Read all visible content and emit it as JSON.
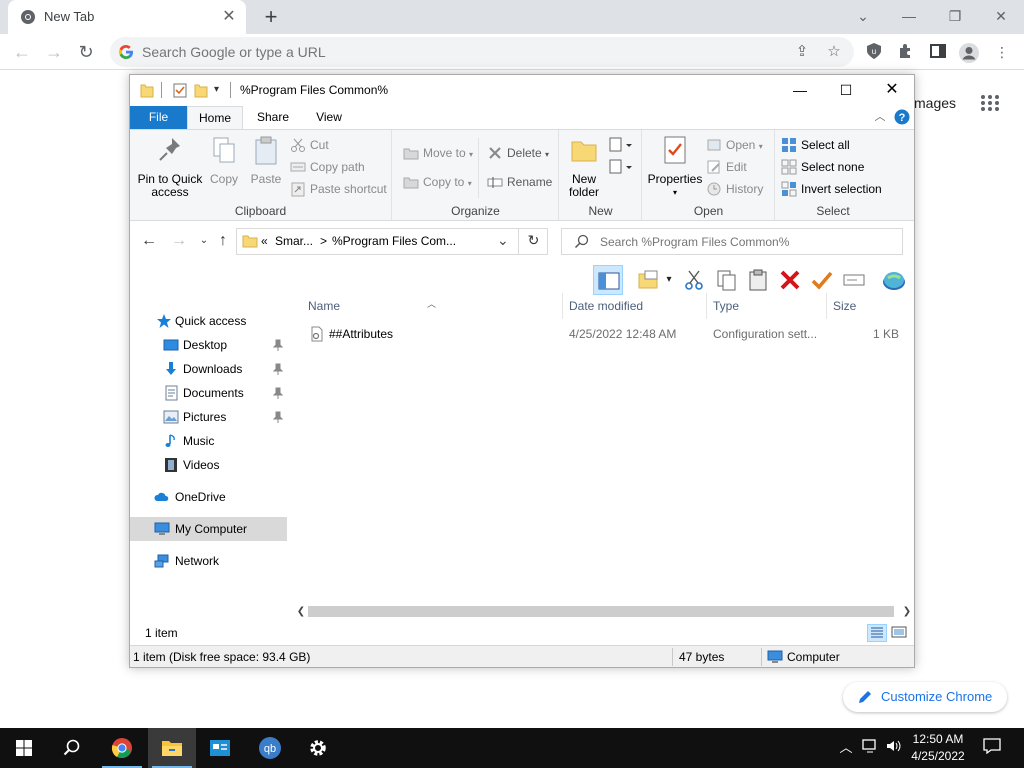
{
  "chrome": {
    "tab_title": "New Tab",
    "tab_close_icon": "close-icon",
    "new_tab_icon": "plus-icon",
    "omnibox_placeholder": "Search Google or type a URL",
    "ntp_apps_text": "mages",
    "customize_label": "Customize Chrome"
  },
  "explorer": {
    "title": "%Program Files Common%",
    "ribbon_tabs": [
      "File",
      "Home",
      "Share",
      "View"
    ],
    "clipboard": {
      "pin_label_1": "Pin to Quick",
      "pin_label_2": "access",
      "copy": "Copy",
      "paste": "Paste",
      "cut": "Cut",
      "copy_path": "Copy path",
      "paste_shortcut": "Paste shortcut",
      "group": "Clipboard"
    },
    "organize": {
      "move_to": "Move to",
      "copy_to": "Copy to",
      "delete": "Delete",
      "rename": "Rename",
      "group": "Organize"
    },
    "new": {
      "new_folder_1": "New",
      "new_folder_2": "folder",
      "group": "New"
    },
    "open": {
      "properties": "Properties",
      "open": "Open",
      "edit": "Edit",
      "history": "History",
      "group": "Open"
    },
    "select": {
      "select_all": "Select all",
      "select_none": "Select none",
      "invert": "Invert selection",
      "group": "Select"
    },
    "address": {
      "chevrons": "«",
      "crumb1": "Smar...",
      "sep": ">",
      "crumb2": "%Program Files Com..."
    },
    "search_placeholder": "Search %Program Files Common%",
    "nav": {
      "quick_access": "Quick access",
      "desktop": "Desktop",
      "downloads": "Downloads",
      "documents": "Documents",
      "pictures": "Pictures",
      "music": "Music",
      "videos": "Videos",
      "onedrive": "OneDrive",
      "my_computer": "My Computer",
      "network": "Network"
    },
    "columns": {
      "name": "Name",
      "date": "Date modified",
      "type": "Type",
      "size": "Size"
    },
    "files": [
      {
        "name": "##Attributes",
        "date": "4/25/2022 12:48 AM",
        "type": "Configuration sett...",
        "size": "1 KB"
      }
    ],
    "status_count": "1 item",
    "status_disk": "1 item (Disk free space: 93.4 GB)",
    "status_bytes": "47 bytes",
    "status_location": "Computer"
  },
  "taskbar": {
    "time": "12:50 AM",
    "date": "4/25/2022"
  },
  "colors": {
    "file_tab": "#1979ca",
    "chrome_tabstrip": "#dee1e6",
    "chrome_blue": "#1a73e8",
    "taskbar": "#101010"
  }
}
